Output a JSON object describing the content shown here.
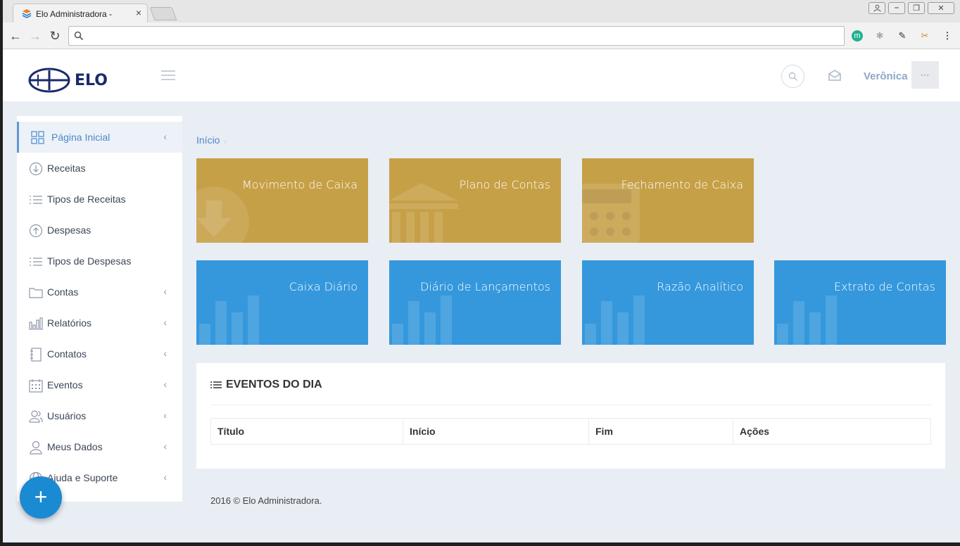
{
  "browser": {
    "tab_title": "Elo Administradora -",
    "tab_close": "×",
    "window_buttons": [
      "⎯",
      "❐",
      "✕"
    ],
    "nav": {
      "back": "←",
      "forward": "→",
      "reload": "↻"
    },
    "url": "",
    "extensions": [
      "m",
      "✱",
      "✎",
      "✂",
      "⋮"
    ]
  },
  "header": {
    "logo_text": "ELO",
    "user_name": "Verônica",
    "avatar_text": "•••"
  },
  "sidebar": {
    "items": [
      {
        "label": "Página Inicial",
        "icon": "grid-icon",
        "arrow": "‹",
        "active": true
      },
      {
        "label": "Receitas",
        "icon": "arrow-down-circle-icon",
        "arrow": ""
      },
      {
        "label": "Tipos de Receitas",
        "icon": "list-icon",
        "arrow": ""
      },
      {
        "label": "Despesas",
        "icon": "arrow-up-circle-icon",
        "arrow": ""
      },
      {
        "label": "Tipos de Despesas",
        "icon": "list-icon",
        "arrow": ""
      },
      {
        "label": "Contas",
        "icon": "folder-icon",
        "arrow": "‹"
      },
      {
        "label": "Relatórios",
        "icon": "bar-chart-icon",
        "arrow": "‹"
      },
      {
        "label": "Contatos",
        "icon": "notebook-icon",
        "arrow": "‹"
      },
      {
        "label": "Eventos",
        "icon": "calendar-icon",
        "arrow": "‹"
      },
      {
        "label": "Usuários",
        "icon": "users-icon",
        "arrow": "‹"
      },
      {
        "label": "Meus Dados",
        "icon": "user-icon",
        "arrow": "‹"
      },
      {
        "label": "Ajuda e Suporte",
        "icon": "globe-icon",
        "arrow": "‹"
      }
    ],
    "fab_label": "+"
  },
  "breadcrumb": {
    "home": "Início",
    "sep": "›"
  },
  "tiles": {
    "gold": [
      {
        "label": "Movimento de Caixa",
        "icon": "download-icon"
      },
      {
        "label": "Plano de Contas",
        "icon": "bank-icon"
      },
      {
        "label": "Fechamento de Caixa",
        "icon": "calculator-icon"
      }
    ],
    "blue": [
      {
        "label": "Caixa Diário",
        "icon": "bar-chart-icon"
      },
      {
        "label": "Diário de Lançamentos",
        "icon": "bar-chart-icon"
      },
      {
        "label": "Razão Analítico",
        "icon": "bar-chart-icon"
      },
      {
        "label": "Extrato de Contas",
        "icon": "bar-chart-icon"
      }
    ],
    "colors": {
      "gold": "#c6a047",
      "blue": "#3598dc"
    }
  },
  "events": {
    "title": "EVENTOS DO DIA",
    "columns": [
      "Título",
      "Início",
      "Fim",
      "Ações"
    ]
  },
  "footer": {
    "text": "2016 © Elo Administradora."
  }
}
